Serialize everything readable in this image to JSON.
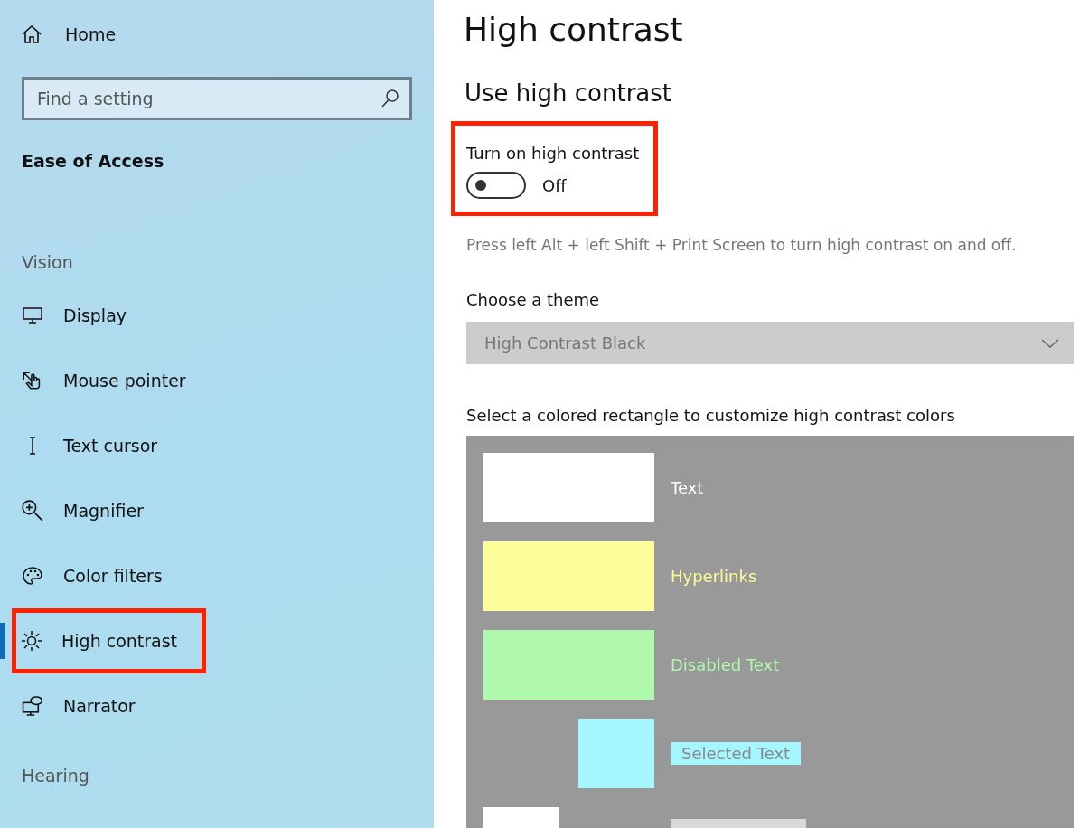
{
  "sidebar": {
    "home": {
      "label": "Home"
    },
    "search": {
      "placeholder": "Find a setting"
    },
    "heading": "Ease of Access",
    "groups": [
      {
        "title": "Vision",
        "items": [
          {
            "label": "Display",
            "selected": false,
            "highlighted": false
          },
          {
            "label": "Mouse pointer",
            "selected": false,
            "highlighted": false
          },
          {
            "label": "Text cursor",
            "selected": false,
            "highlighted": false
          },
          {
            "label": "Magnifier",
            "selected": false,
            "highlighted": false
          },
          {
            "label": "Color filters",
            "selected": false,
            "highlighted": false
          },
          {
            "label": "High contrast",
            "selected": true,
            "highlighted": true
          },
          {
            "label": "Narrator",
            "selected": false,
            "highlighted": false
          }
        ]
      },
      {
        "title": "Hearing"
      }
    ]
  },
  "main": {
    "title": "High contrast",
    "section_title": "Use high contrast",
    "toggle": {
      "label": "Turn on high contrast",
      "on": false,
      "state_text": "Off",
      "highlighted": true
    },
    "shortcut_hint": "Press left Alt + left Shift + Print Screen to turn high contrast on and off.",
    "theme": {
      "label": "Choose a theme",
      "value": "High Contrast Black",
      "disabled": true
    },
    "colors": {
      "label": "Select a colored rectangle to customize high contrast colors",
      "rows": [
        {
          "kind": "foreground",
          "color": "#ffffff",
          "label": "Text"
        },
        {
          "kind": "foreground",
          "color": "#fdfd99",
          "label": "Hyperlinks"
        },
        {
          "kind": "foreground",
          "color": "#b1f8af",
          "label": "Disabled Text"
        },
        {
          "kind": "selected",
          "color": "#a4f6ff",
          "label": "Selected Text"
        },
        {
          "kind": "button",
          "color": "#ffffff"
        }
      ]
    }
  }
}
